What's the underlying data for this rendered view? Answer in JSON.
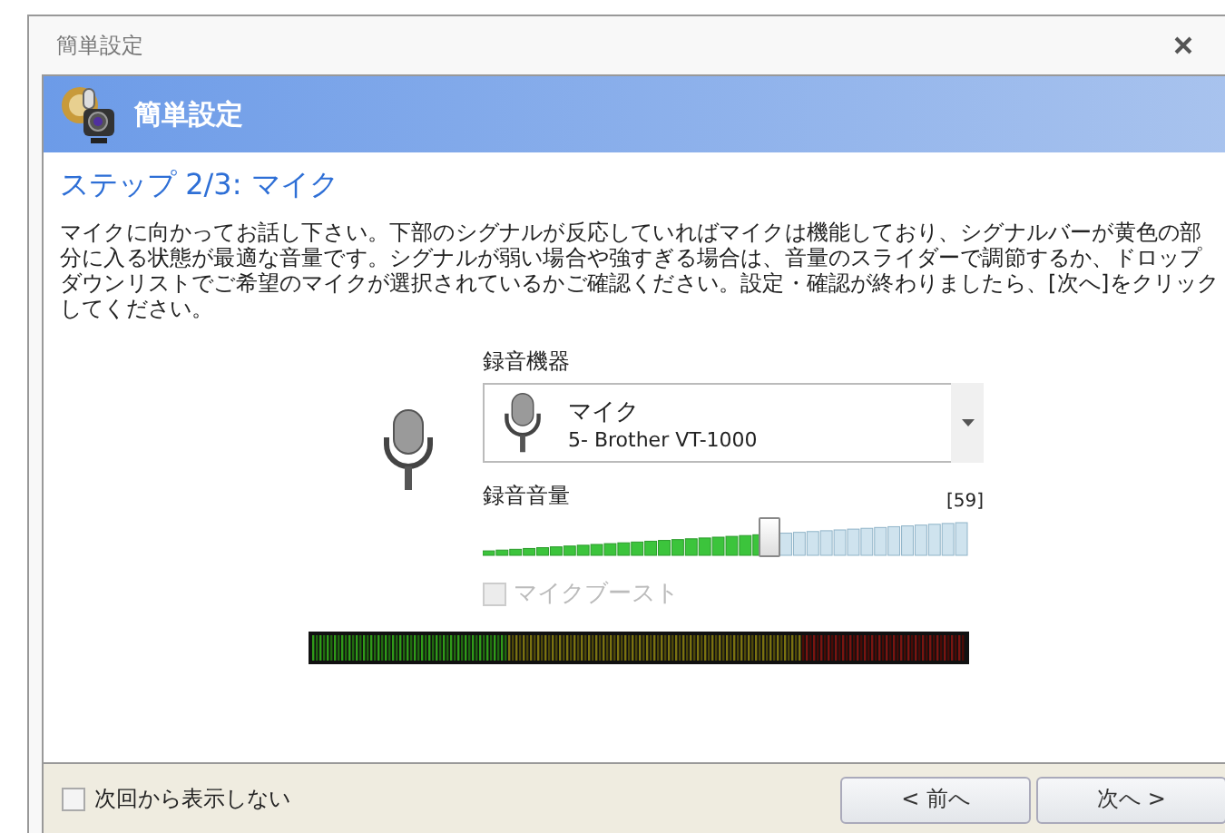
{
  "window": {
    "title": "簡単設定"
  },
  "header": {
    "title": "簡単設定"
  },
  "step": {
    "title": "ステップ 2/3: マイク",
    "description": "マイクに向かってお話し下さい。下部のシグナルが反応していればマイクは機能しており、シグナルバーが黄色の部分に入る状態が最適な音量です。シグナルが弱い場合や強すぎる場合は、音量のスライダーで調節するか、ドロップダウンリストでご希望のマイクが選択されているかご確認ください。設定・確認が終わりましたら、[次へ]をクリックしてください。"
  },
  "device": {
    "label": "録音機器",
    "name": "マイク",
    "detail": "5- Brother VT-1000"
  },
  "volume": {
    "label": "録音音量",
    "reading": "[59]",
    "level": 0.59
  },
  "boost": {
    "label": "マイクブースト",
    "checked": false,
    "disabled": true
  },
  "footer": {
    "dont_show": {
      "label": "次回から表示しない",
      "checked": false
    },
    "buttons": [
      "< 前へ",
      "次へ >"
    ]
  }
}
